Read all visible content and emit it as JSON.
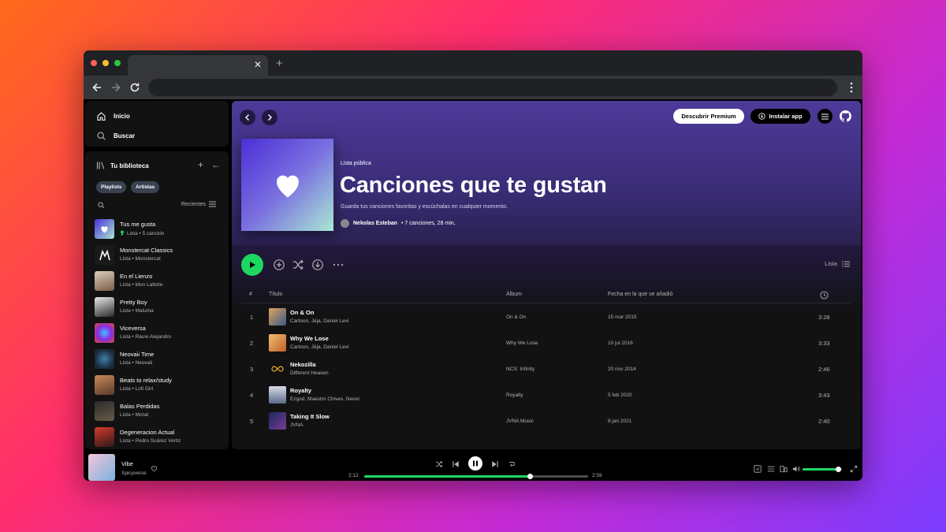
{
  "app": {
    "nav": {
      "home_label": "Inicio",
      "search_label": "Buscar"
    },
    "library": {
      "title": "Tu biblioteca",
      "chips": [
        "Playlists",
        "Artistas"
      ],
      "sort_label": "Recientes",
      "items": [
        {
          "title": "Tus me gusta",
          "subtitle": "Lista • 5 canción"
        },
        {
          "title": "Monstercat Classics",
          "subtitle": "Lista • Monstercat"
        },
        {
          "title": "En el Lienzo",
          "subtitle": "Lista • Mon Laferte"
        },
        {
          "title": "Pretty Boy",
          "subtitle": "Lista • Maluma"
        },
        {
          "title": "Viceversa",
          "subtitle": "Lista • Rauw Alejandro"
        },
        {
          "title": "Neovaii Time",
          "subtitle": "Lista • Neovaii"
        },
        {
          "title": "Beats to relax/study",
          "subtitle": "Lista • Lofi Girl"
        },
        {
          "title": "Balas Perdidas",
          "subtitle": "Lista • Morat"
        },
        {
          "title": "Degeneracion Actual",
          "subtitle": "Lista • Pedro Suárez Vertiz"
        }
      ]
    },
    "header": {
      "premium_label": "Descubrir Premium",
      "install_label": "Instalar app"
    },
    "playlist": {
      "type": "Lista pública",
      "title": "Canciones que te gustan",
      "description": "Guarda tus canciones favoritas y escúchalas en cualquier momento.",
      "owner": "Nekolas Esteban",
      "meta": "• 7 canciones, 28 min,"
    },
    "controls": {
      "view_label": "Lista"
    },
    "table": {
      "headers": {
        "num": "#",
        "title": "Título",
        "album": "Álbum",
        "date": "Fecha en la que se añadió"
      },
      "rows": [
        {
          "num": "1",
          "title": "On & On",
          "artist": "Cartoon, Jéja, Daniel Levi",
          "album": "On & On",
          "date": "15 mar 2015",
          "duration": "3:28"
        },
        {
          "num": "2",
          "title": "Why We Lose",
          "artist": "Cartoon, Jéja, Daniel Levi",
          "album": "Why We Lose",
          "date": "10 jul 2016",
          "duration": "3:33"
        },
        {
          "num": "3",
          "title": "Nekozilla",
          "artist": "Different Heaven",
          "album": "NCS: Infinity",
          "date": "20 nov 2014",
          "duration": "2:46"
        },
        {
          "num": "4",
          "title": "Royalty",
          "artist": "Ezgod, Maestro Chives, Neoni",
          "album": "Royalty",
          "date": "5 feb 2020",
          "duration": "3:43"
        },
        {
          "num": "5",
          "title": "Taking It Slow",
          "artist": "JVNA",
          "album": "JVNA Music",
          "date": "8 jan 2021",
          "duration": "2:40"
        }
      ]
    },
    "player": {
      "title": "Vibe",
      "artist": "Spicyverse",
      "elapsed": "2:12",
      "total": "2:59",
      "progress": 0.74,
      "volume": 0.9
    }
  },
  "colors": {
    "accent": "#1ed760",
    "hero_top": "#4d3a9a",
    "surface": "#121212"
  },
  "icons": [
    "home-icon",
    "search-icon",
    "library-icon",
    "heart-icon",
    "github-icon",
    "shuffle-icon",
    "download-icon"
  ]
}
